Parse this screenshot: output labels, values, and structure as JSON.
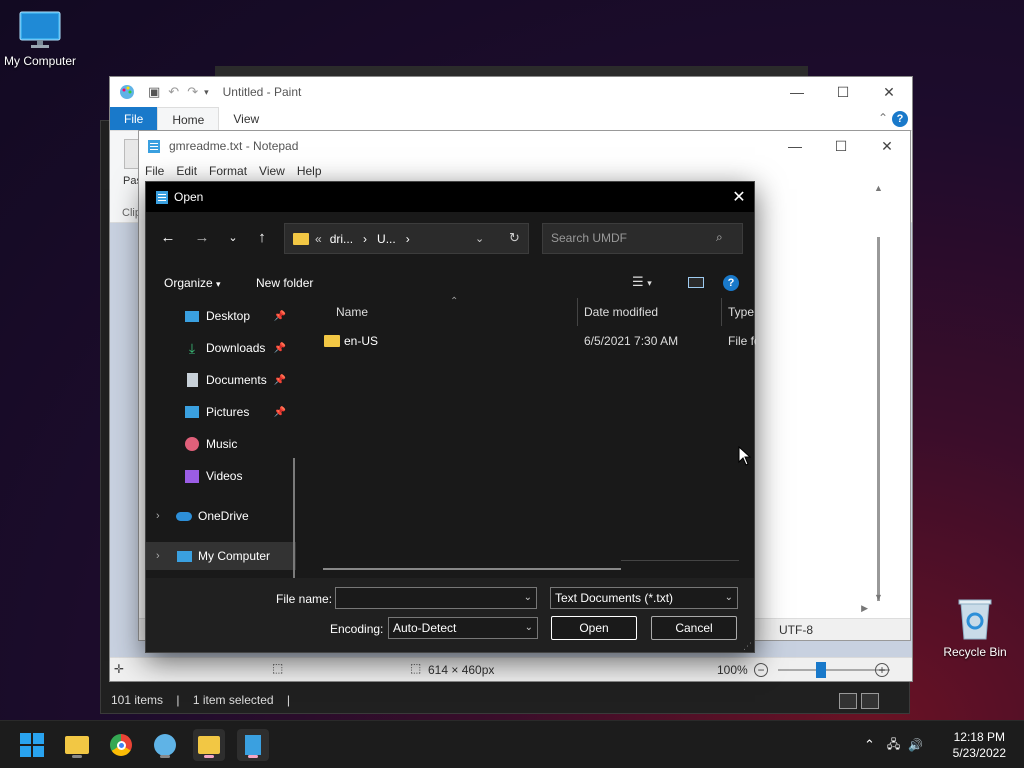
{
  "desktop": {
    "icons": [
      {
        "label": "My Computer",
        "icon": "monitor-icon"
      },
      {
        "label": "Recycle Bin",
        "icon": "recycle-bin-icon"
      }
    ]
  },
  "explorer": {
    "status": {
      "items": "101 items",
      "selected": "1 item selected",
      "sep": "|"
    }
  },
  "paint": {
    "title": "Untitled - Paint",
    "tabs": {
      "file": "File",
      "home": "Home",
      "view": "View"
    },
    "ribbon_partial": {
      "paste": "Pas",
      "clipboard": "Clip"
    },
    "status": {
      "size": "614 × 460px",
      "zoom": "100%"
    }
  },
  "notepad": {
    "title": "gmreadme.txt - Notepad",
    "menu": [
      "File",
      "Edit",
      "Format",
      "View",
      "Help"
    ],
    "status": {
      "encoding": "UTF-8"
    }
  },
  "open_dialog": {
    "title": "Open",
    "address": {
      "root": "«",
      "seg1": "dri...",
      "sep": "›",
      "seg2": "U..."
    },
    "search_placeholder": "Search UMDF",
    "toolbar": {
      "organize": "Organize",
      "new_folder": "New folder"
    },
    "nav": [
      {
        "label": "Desktop",
        "icon": "desktop-icon",
        "pinned": true
      },
      {
        "label": "Downloads",
        "icon": "download-icon",
        "pinned": true
      },
      {
        "label": "Documents",
        "icon": "documents-icon",
        "pinned": true
      },
      {
        "label": "Pictures",
        "icon": "pictures-icon",
        "pinned": true
      },
      {
        "label": "Music",
        "icon": "music-icon",
        "pinned": false
      },
      {
        "label": "Videos",
        "icon": "videos-icon",
        "pinned": false
      },
      {
        "label": "OneDrive",
        "icon": "cloud-icon",
        "pinned": false
      },
      {
        "label": "My Computer",
        "icon": "monitor-icon",
        "pinned": false
      }
    ],
    "columns": {
      "name": "Name",
      "date": "Date modified",
      "type": "Type"
    },
    "files": [
      {
        "name": "en-US",
        "date": "6/5/2021 7:30 AM",
        "type": "File fo"
      }
    ],
    "file_name_label": "File name:",
    "file_name_value": "",
    "file_type": "Text Documents (*.txt)",
    "encoding_label": "Encoding:",
    "encoding_value": "Auto-Detect",
    "open_button": "Open",
    "cancel_button": "Cancel"
  },
  "taskbar": {
    "clock_time": "12:18 PM",
    "clock_date": "5/23/2022"
  },
  "colors": {
    "accent": "#1979ca",
    "folder": "#f2c744",
    "dialog_bg": "#191919"
  }
}
